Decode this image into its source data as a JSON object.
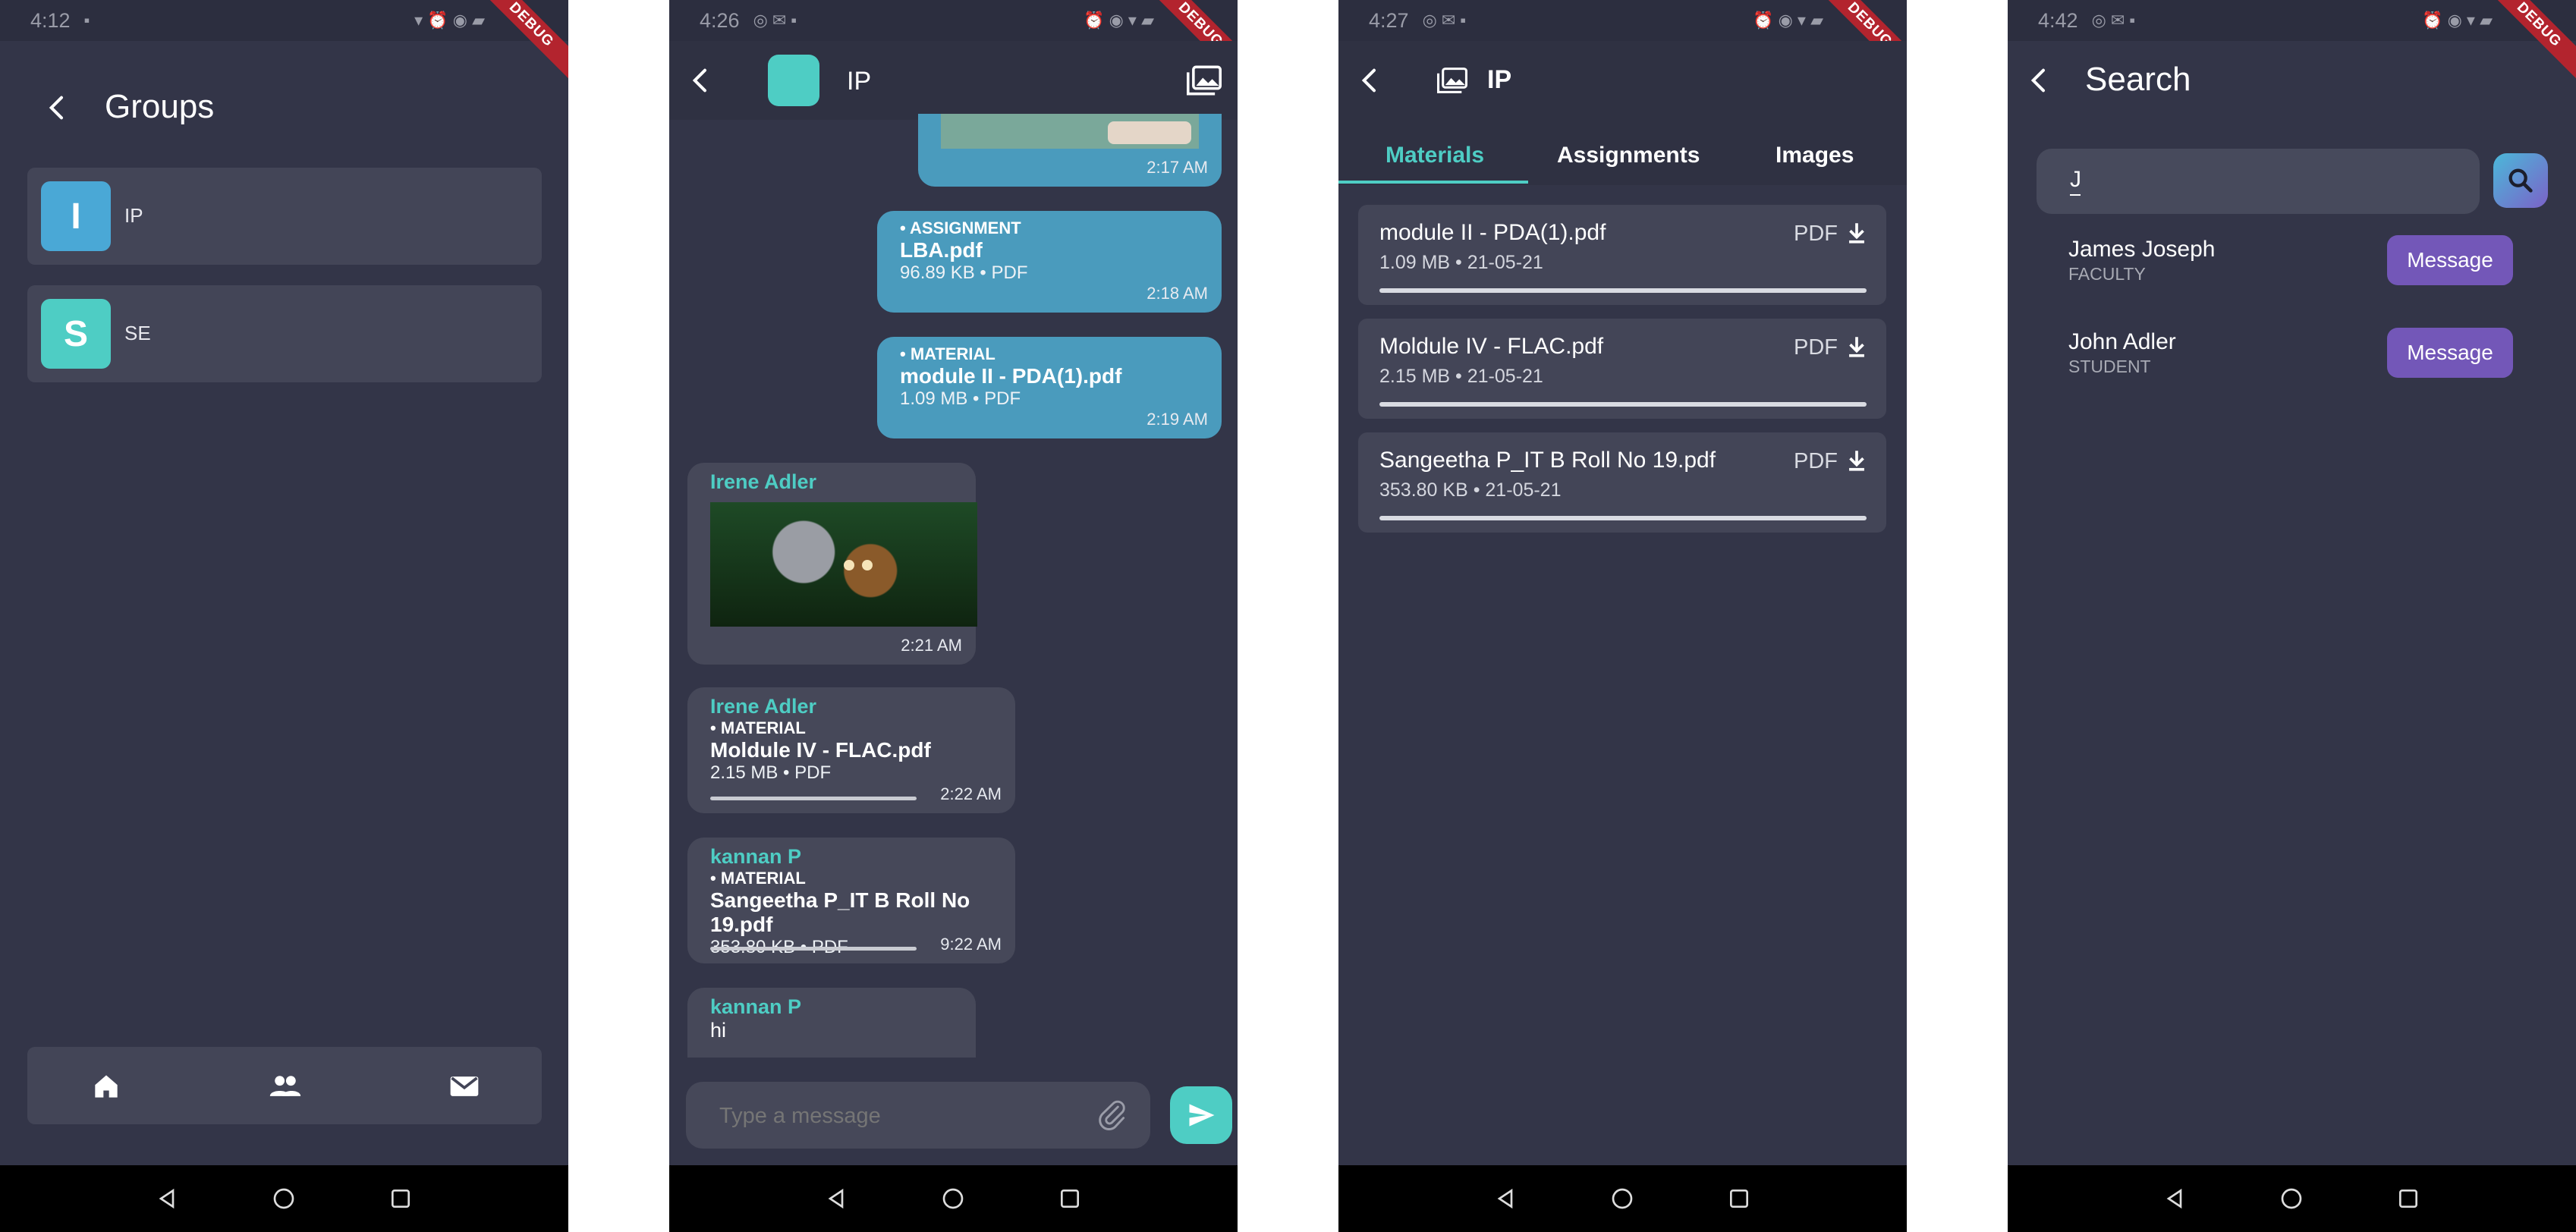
{
  "screens": {
    "groups": {
      "status_time": "4:12",
      "title": "Groups",
      "groups": [
        {
          "letter": "I",
          "name": "IP",
          "color": "#4aa8d6"
        },
        {
          "letter": "S",
          "name": "SE",
          "color": "#4ecdc4"
        }
      ]
    },
    "chat": {
      "status_time": "4:26",
      "title": "IP",
      "messages": {
        "m0_time": "2:17 AM",
        "m1_tag": "• ASSIGNMENT",
        "m1_name": "LBA.pdf",
        "m1_meta": "96.89 KB • PDF",
        "m1_time": "2:18 AM",
        "m2_tag": "• MATERIAL",
        "m2_name": "module II - PDA(1).pdf",
        "m2_meta": "1.09 MB • PDF",
        "m2_time": "2:19 AM",
        "m3_sender": "Irene Adler",
        "m3_time": "2:21 AM",
        "m4_sender": "Irene Adler",
        "m4_tag": "• MATERIAL",
        "m4_name": "Moldule IV - FLAC.pdf",
        "m4_meta": "2.15 MB • PDF",
        "m4_time": "2:22 AM",
        "m5_sender": "kannan P",
        "m5_tag": "• MATERIAL",
        "m5_name": "Sangeetha P_IT B Roll No 19.pdf",
        "m5_meta": "353.80 KB • PDF",
        "m5_time": "9:22 AM",
        "m6_sender": "kannan P",
        "m6_text": "hi"
      },
      "input_placeholder": "Type a message"
    },
    "materials": {
      "status_time": "4:27",
      "title": "IP",
      "tabs": [
        "Materials",
        "Assignments",
        "Images"
      ],
      "items": [
        {
          "name": "module II - PDA(1).pdf",
          "meta": "1.09 MB  •  21-05-21",
          "type": "PDF"
        },
        {
          "name": "Moldule IV - FLAC.pdf",
          "meta": "2.15 MB  •  21-05-21",
          "type": "PDF"
        },
        {
          "name": "Sangeetha P_IT B Roll No 19.pdf",
          "meta": "353.80 KB  •  21-05-21",
          "type": "PDF"
        }
      ]
    },
    "search": {
      "status_time": "4:42",
      "title": "Search",
      "query": "J",
      "results": [
        {
          "name": "James Joseph",
          "role": "FACULTY",
          "action": "Message"
        },
        {
          "name": "John Adler",
          "role": "STUDENT",
          "action": "Message"
        }
      ]
    }
  },
  "debug_banner": "DEBUG",
  "colors": {
    "background": "#333548",
    "card": "#434557",
    "accent": "#4ecdc4",
    "outgoing_bubble": "#4a9bbd",
    "message_button": "#7357b8",
    "debug_banner": "#b3242e"
  }
}
